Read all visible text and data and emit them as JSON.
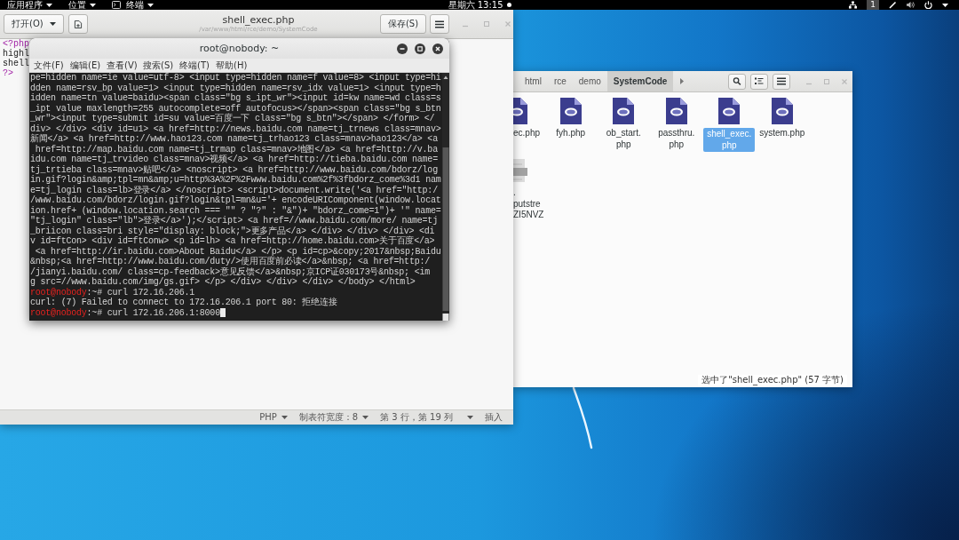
{
  "top_bar": {
    "menus": [
      {
        "label": "应用程序",
        "kind": "plain"
      },
      {
        "label": "位置",
        "kind": "plain"
      },
      {
        "label": "终端",
        "kind": "app"
      }
    ],
    "clock": "星期六 13:15",
    "workspace": "1"
  },
  "editor_window": {
    "open_button": "打开(O)",
    "title": "shell_exec.php",
    "subtitle": "/var/www/html/rce/demo/SystemCode",
    "save_button": "保存(S)",
    "lines": [
      {
        "kind": "tag",
        "text": "<?php"
      },
      {
        "kind": "code",
        "text": "highl"
      },
      {
        "kind": "code",
        "text": "shell"
      },
      {
        "kind": "tag",
        "text": "?>"
      }
    ],
    "status": [
      {
        "label": "PHP",
        "dropdown": true
      },
      {
        "label": "制表符宽度：8",
        "dropdown": true
      },
      {
        "label": "第 3 行，第 19 列",
        "dropdown": true
      },
      {
        "label": "插入",
        "dropdown": false
      }
    ]
  },
  "terminal_window": {
    "title": "root@nobody: ~",
    "menus": [
      "文件(F)",
      "编辑(E)",
      "查看(V)",
      "搜索(S)",
      "终端(T)",
      "帮助(H)"
    ],
    "lines": [
      {
        "kind": "output",
        "text": "pe=hidden name=ie value=utf-8> <input type=hidden name=f value=8> <input type=hi"
      },
      {
        "kind": "output",
        "text": "dden name=rsv_bp value=1> <input type=hidden name=rsv_idx value=1> <input type=h"
      },
      {
        "kind": "output",
        "text": "idden name=tn value=baidu><span class=\"bg s_ipt_wr\"><input id=kw name=wd class=s"
      },
      {
        "kind": "output",
        "text": "_ipt value maxlength=255 autocomplete=off autofocus></span><span class=\"bg s_btn"
      },
      {
        "kind": "output",
        "text": "_wr\"><input type=submit id=su value=百度一下 class=\"bg s_btn\"></span> </form> </"
      },
      {
        "kind": "output",
        "text": "div> </div> <div id=u1> <a href=http://news.baidu.com name=tj_trnews class=mnav>"
      },
      {
        "kind": "output",
        "text": "新闻</a> <a href=http://www.hao123.com name=tj_trhao123 class=mnav>hao123</a> <a"
      },
      {
        "kind": "output",
        "text": " href=http://map.baidu.com name=tj_trmap class=mnav>地图</a> <a href=http://v.ba"
      },
      {
        "kind": "output",
        "text": "idu.com name=tj_trvideo class=mnav>视频</a> <a href=http://tieba.baidu.com name="
      },
      {
        "kind": "output",
        "text": "tj_trtieba class=mnav>贴吧</a> <noscript> <a href=http://www.baidu.com/bdorz/log"
      },
      {
        "kind": "output",
        "text": "in.gif?login&amp;tpl=mn&amp;u=http%3A%2F%2Fwww.baidu.com%2f%3fbdorz_come%3d1 nam"
      },
      {
        "kind": "output",
        "text": "e=tj_login class=lb>登录</a> </noscript> <script>document.write('<a href=\"http:/"
      },
      {
        "kind": "output",
        "text": "/www.baidu.com/bdorz/login.gif?login&tpl=mn&u='+ encodeURIComponent(window.locat"
      },
      {
        "kind": "output",
        "text": "ion.href+ (window.location.search === \"\" ? \"?\" : \"&\")+ \"bdorz_come=1\")+ '\" name="
      },
      {
        "kind": "output",
        "text": "\"tj_login\" class=\"lb\">登录</a>');</script> <a href=//www.baidu.com/more/ name=tj"
      },
      {
        "kind": "output",
        "text": "_briicon class=bri style=\"display: block;\">更多产品</a> </div> </div> </div> <di"
      },
      {
        "kind": "output",
        "text": "v id=ftCon> <div id=ftConw> <p id=lh> <a href=http://home.baidu.com>关于百度</a>"
      },
      {
        "kind": "output",
        "text": " <a href=http://ir.baidu.com>About Baidu</a> </p> <p id=cp>&copy;2017&nbsp;Baidu"
      },
      {
        "kind": "output",
        "text": "&nbsp;<a href=http://www.baidu.com/duty/>使用百度前必读</a>&nbsp; <a href=http:/"
      },
      {
        "kind": "output",
        "text": "/jianyi.baidu.com/ class=cp-feedback>意见反馈</a>&nbsp;京ICP证030173号&nbsp; <im"
      },
      {
        "kind": "output",
        "text": "g src=//www.baidu.com/img/gs.gif> </p> </div> </div> </div> </body> </html>"
      },
      {
        "kind": "prompt",
        "user": "root@nobody",
        "path": ":~#",
        "command": "curl 172.16.206.1"
      },
      {
        "kind": "output",
        "text": "curl: (7) Failed to connect to 172.16.206.1 port 80: 拒绝连接"
      },
      {
        "kind": "prompt",
        "user": "root@nobody",
        "path": ":~#",
        "command": "curl 172.16.206.1:8000"
      }
    ],
    "cursor": true
  },
  "file_window": {
    "breadcrumbs": [
      {
        "label": "html",
        "selected": false
      },
      {
        "label": "rce",
        "selected": false
      },
      {
        "label": "demo",
        "selected": false
      },
      {
        "label": "SystemCode",
        "selected": true
      }
    ],
    "files": [
      {
        "kind": "php",
        "name": "ec.php",
        "selected": false
      },
      {
        "kind": "php",
        "name": "fyh.php",
        "selected": false
      },
      {
        "kind": "php",
        "name": "ob_start.\nphp",
        "selected": false
      },
      {
        "kind": "php",
        "name": "passthru.\nphp",
        "selected": false
      },
      {
        "kind": "php",
        "name": "shell_exec.\nphp",
        "selected": true
      },
      {
        "kind": "php",
        "name": "system.php",
        "selected": false
      },
      {
        "kind": "generic",
        "name": ".\nputstre\nZI5NVZ",
        "selected": false
      }
    ],
    "status": "选中了\"shell_exec.php\" (57 字节)"
  }
}
